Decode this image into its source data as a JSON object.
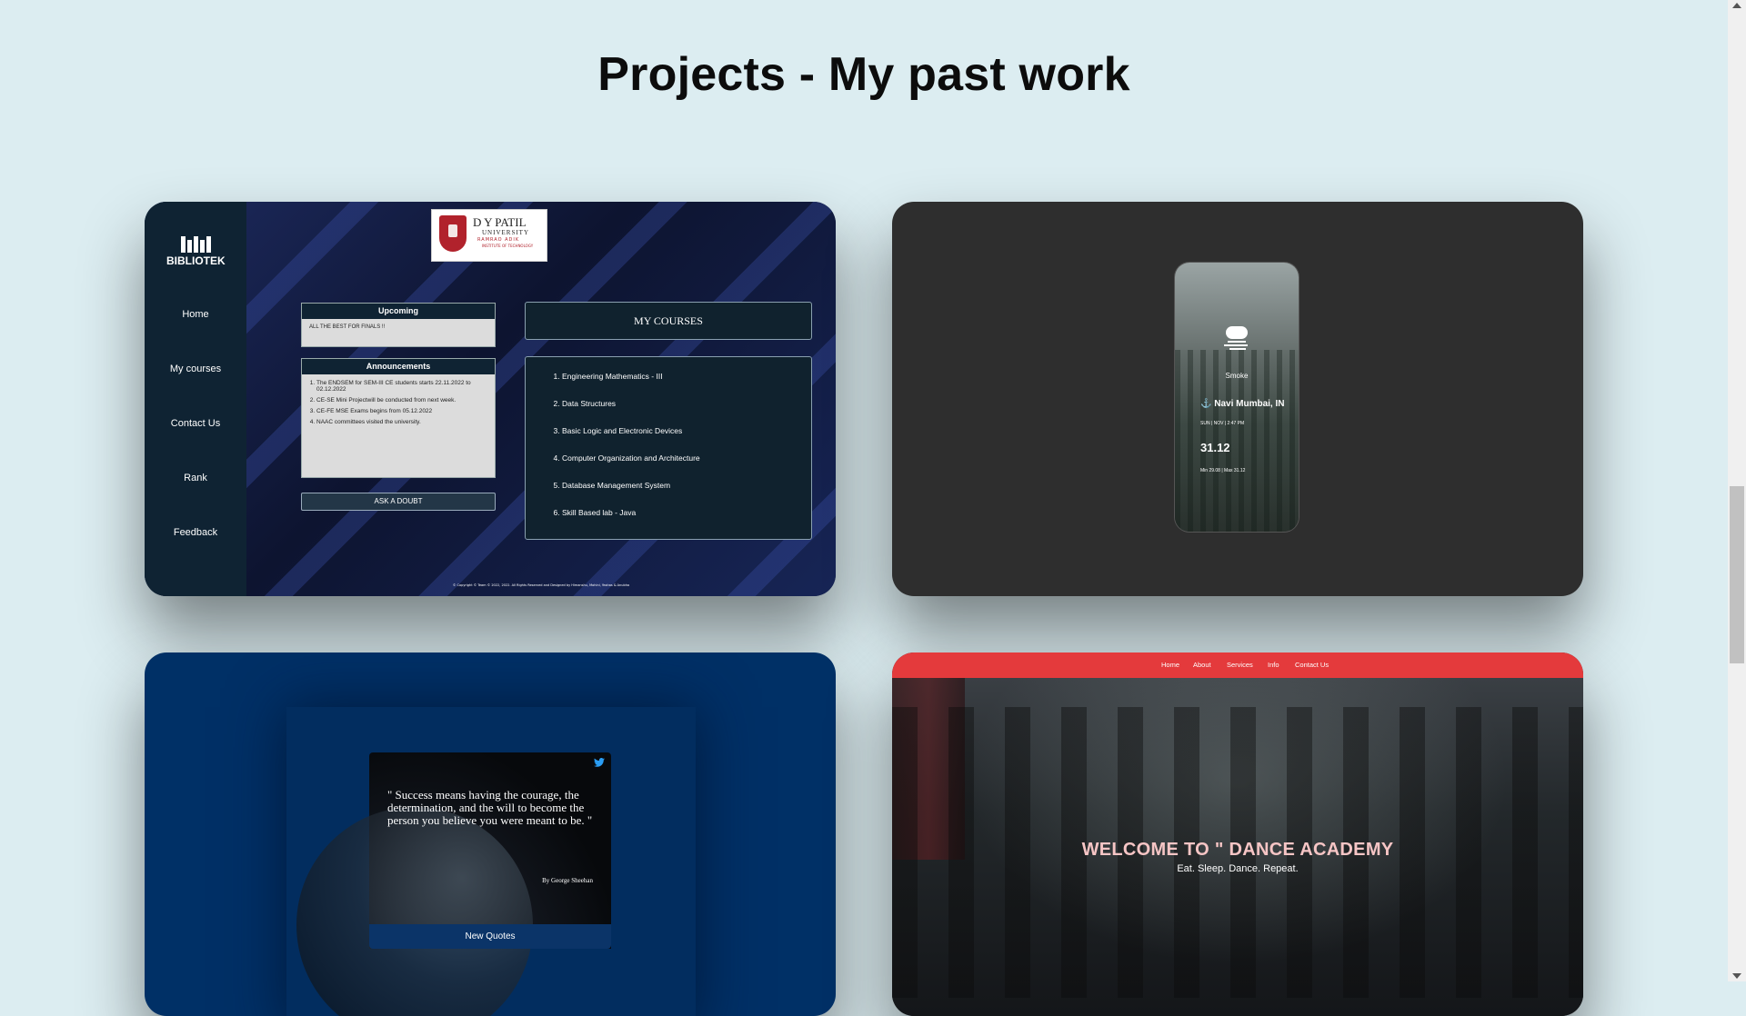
{
  "page": {
    "title": "Projects - My past work"
  },
  "bibliotek": {
    "logo_text": "BIBLIOTEK",
    "nav": [
      "Home",
      "My courses",
      "Contact Us",
      "Rank",
      "Feedback"
    ],
    "university": {
      "line1": "D Y PATIL",
      "line2": "UNIVERSITY",
      "line3": "RAMRAO ADIK",
      "line4": "INSTITUTE OF TECHNOLOGY"
    },
    "upcoming": {
      "title": "Upcoming",
      "text": "ALL THE BEST FOR FINALS !!"
    },
    "announcements": {
      "title": "Announcements",
      "items": [
        "The ENDSEM for SEM-III CE students starts 22.11.2022 to 02.12.2022",
        "CE-SE Mini Projectwill be conducted from next week.",
        "CE-FE MSE Exams begins from 05.12.2022",
        "NAAC committees visited the university."
      ]
    },
    "ask_doubt": "ASK A DOUBT",
    "my_courses": "MY COURSES",
    "courses": [
      "Engineering Mathematics - III",
      "Data Structures",
      "Basic Logic and Electronic Devices",
      "Computer Organization and Architecture",
      "Database Management System",
      "Skill Based lab - Java"
    ],
    "footer": "© Copyright © Team © 2022, 2022. All Rights Reserved and Designed by Himanshu, Mohini, Yashas & Anubha"
  },
  "weather": {
    "condition": "Smoke",
    "location": "Navi Mumbai, IN",
    "date": "SUN | NOV | 2:47 PM",
    "temperature": "31.12",
    "minmax": "Min 29.08 | Max 31.12"
  },
  "quote": {
    "text": "\" Success means having the courage, the determination, and the will to become the person you believe you were meant to be. \"",
    "author": "By George Sheehan",
    "button": "New Quotes"
  },
  "dance": {
    "nav": [
      "Home",
      "About",
      "Services",
      "Info",
      "Contact Us"
    ],
    "title": "WELCOME TO \" DANCE ACADEMY",
    "subtitle": "Eat. Sleep. Dance. Repeat."
  },
  "colors": {
    "background": "#dcedf1",
    "dance_nav": "#e43a3c",
    "quote_bg": "#003066"
  }
}
